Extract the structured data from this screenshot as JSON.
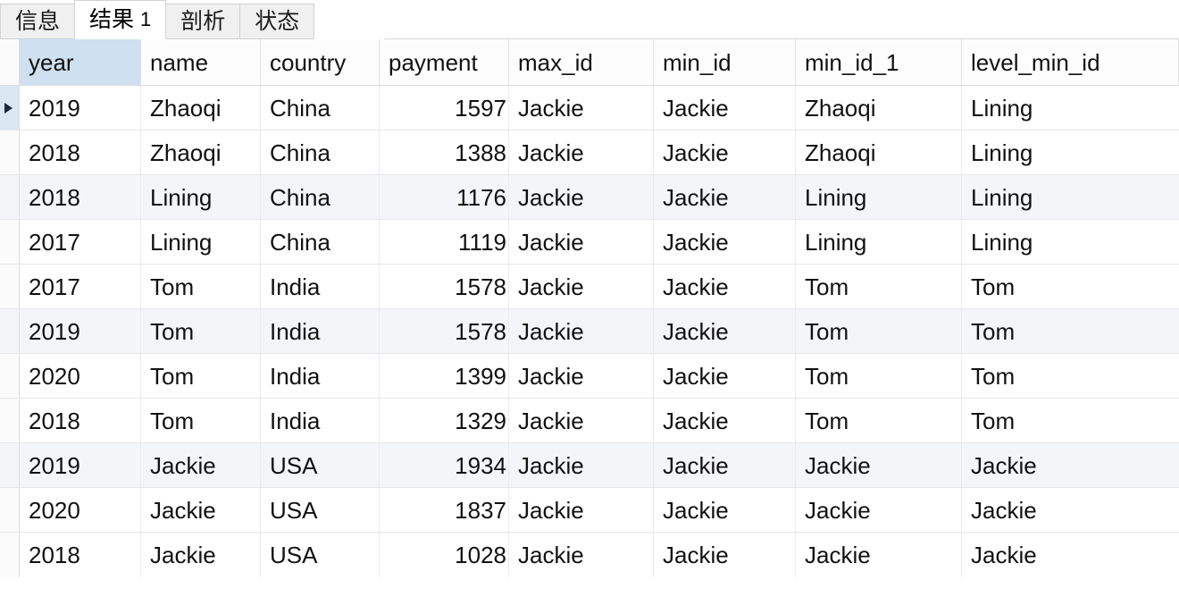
{
  "window": {
    "result_tab_active": "结果 1"
  },
  "tabs": [
    {
      "label": "信息",
      "active": false,
      "name": "tab-info"
    },
    {
      "label": "结果",
      "suffix": "1",
      "active": true,
      "name": "tab-result-1"
    },
    {
      "label": "剖析",
      "active": false,
      "name": "tab-profile"
    },
    {
      "label": "状态",
      "active": false,
      "name": "tab-status"
    }
  ],
  "grid": {
    "selected_column": "year",
    "current_row_index": 0,
    "columns": [
      {
        "key": "year",
        "label": "year",
        "align": "left"
      },
      {
        "key": "name",
        "label": "name",
        "align": "left"
      },
      {
        "key": "country",
        "label": "country",
        "align": "left"
      },
      {
        "key": "payment",
        "label": "payment",
        "align": "right"
      },
      {
        "key": "max_id",
        "label": "max_id",
        "align": "left"
      },
      {
        "key": "min_id",
        "label": "min_id",
        "align": "left"
      },
      {
        "key": "min_id_1",
        "label": "min_id_1",
        "align": "left"
      },
      {
        "key": "level_min_id",
        "label": "level_min_id",
        "align": "left"
      }
    ],
    "rows": [
      {
        "year": "2019",
        "name": "Zhaoqi",
        "country": "China",
        "payment": "1597",
        "max_id": "Jackie",
        "min_id": "Jackie",
        "min_id_1": "Zhaoqi",
        "level_min_id": "Lining"
      },
      {
        "year": "2018",
        "name": "Zhaoqi",
        "country": "China",
        "payment": "1388",
        "max_id": "Jackie",
        "min_id": "Jackie",
        "min_id_1": "Zhaoqi",
        "level_min_id": "Lining"
      },
      {
        "year": "2018",
        "name": "Lining",
        "country": "China",
        "payment": "1176",
        "max_id": "Jackie",
        "min_id": "Jackie",
        "min_id_1": "Lining",
        "level_min_id": "Lining"
      },
      {
        "year": "2017",
        "name": "Lining",
        "country": "China",
        "payment": "1119",
        "max_id": "Jackie",
        "min_id": "Jackie",
        "min_id_1": "Lining",
        "level_min_id": "Lining"
      },
      {
        "year": "2017",
        "name": "Tom",
        "country": "India",
        "payment": "1578",
        "max_id": "Jackie",
        "min_id": "Jackie",
        "min_id_1": "Tom",
        "level_min_id": "Tom"
      },
      {
        "year": "2019",
        "name": "Tom",
        "country": "India",
        "payment": "1578",
        "max_id": "Jackie",
        "min_id": "Jackie",
        "min_id_1": "Tom",
        "level_min_id": "Tom"
      },
      {
        "year": "2020",
        "name": "Tom",
        "country": "India",
        "payment": "1399",
        "max_id": "Jackie",
        "min_id": "Jackie",
        "min_id_1": "Tom",
        "level_min_id": "Tom"
      },
      {
        "year": "2018",
        "name": "Tom",
        "country": "India",
        "payment": "1329",
        "max_id": "Jackie",
        "min_id": "Jackie",
        "min_id_1": "Tom",
        "level_min_id": "Tom"
      },
      {
        "year": "2019",
        "name": "Jackie",
        "country": "USA",
        "payment": "1934",
        "max_id": "Jackie",
        "min_id": "Jackie",
        "min_id_1": "Jackie",
        "level_min_id": "Jackie"
      },
      {
        "year": "2020",
        "name": "Jackie",
        "country": "USA",
        "payment": "1837",
        "max_id": "Jackie",
        "min_id": "Jackie",
        "min_id_1": "Jackie",
        "level_min_id": "Jackie"
      },
      {
        "year": "2018",
        "name": "Jackie",
        "country": "USA",
        "payment": "1028",
        "max_id": "Jackie",
        "min_id": "Jackie",
        "min_id_1": "Jackie",
        "level_min_id": "Jackie"
      }
    ],
    "striped_row_indexes": [
      2,
      5,
      8
    ],
    "colors": {
      "header_selected_bg": "#cfe0f0",
      "current_row_gutter_bg": "#dbe8f4",
      "stripe_bg": "#f4f5f8",
      "grid_line": "#e7e7ea",
      "text": "#111111",
      "tab_inactive_bg": "#f0f0f0",
      "tab_active_bg": "#ffffff"
    }
  }
}
